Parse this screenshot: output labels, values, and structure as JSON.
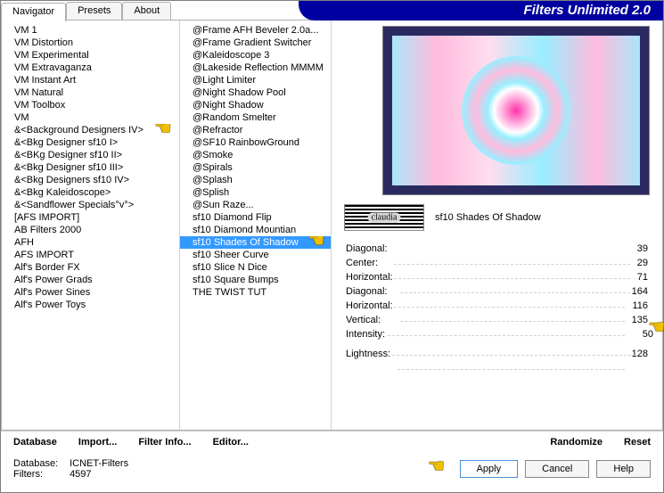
{
  "app": {
    "title": "Filters Unlimited 2.0"
  },
  "tabs": {
    "items": [
      "Navigator",
      "Presets",
      "About"
    ],
    "active_index": 0
  },
  "categories": {
    "items": [
      "VM 1",
      "VM Distortion",
      "VM Experimental",
      "VM Extravaganza",
      "VM Instant Art",
      "VM Natural",
      "VM Toolbox",
      "VM",
      "&<Background Designers IV>",
      "&<Bkg Designer sf10 I>",
      "&<BKg Designer sf10 II>",
      "&<Bkg Designer sf10 III>",
      "&<Bkg Designers sf10 IV>",
      "&<Bkg Kaleidoscope>",
      "&<Sandflower Specials°v°>",
      "[AFS IMPORT]",
      "AB Filters 2000",
      "AFH",
      "AFS IMPORT",
      "Alf's Border FX",
      "Alf's Power Grads",
      "Alf's Power Sines",
      "Alf's Power Toys"
    ],
    "highlighted_index": 8
  },
  "filters": {
    "items": [
      "@Frame AFH Beveler 2.0a...",
      "@Frame Gradient Switcher",
      "@Kaleidoscope 3",
      "@Lakeside Reflection MMMM",
      "@Light Limiter",
      "@Night Shadow Pool",
      "@Night Shadow",
      "@Random Smelter",
      "@Refractor",
      "@SF10 RainbowGround",
      "@Smoke",
      "@Spirals",
      "@Splash",
      "@Splish",
      "@Sun Raze...",
      "sf10 Diamond Flip",
      "sf10 Diamond Mountian",
      "sf10 Shades Of Shadow",
      "sf10 Sheer Curve",
      "sf10 Slice N Dice",
      "sf10 Square Bumps",
      "THE TWIST TUT"
    ],
    "selected_index": 17
  },
  "preview": {
    "filter_name": "sf10 Shades Of Shadow",
    "watermark_text": "claudia"
  },
  "params": [
    {
      "label": "Diagonal:",
      "value": 39
    },
    {
      "label": "Center:",
      "value": 29
    },
    {
      "label": "Horizontal:",
      "value": 71
    },
    {
      "label": "Diagonal:",
      "value": 164
    },
    {
      "label": "Horizontal:",
      "value": 116
    },
    {
      "label": "Vertical:",
      "value": 135
    },
    {
      "label": "Intensity:",
      "value": 50
    },
    {
      "label": "Lightness:",
      "value": 128
    }
  ],
  "bottom_links": {
    "database": "Database",
    "import": "Import...",
    "filter_info": "Filter Info...",
    "editor": "Editor...",
    "randomize": "Randomize",
    "reset": "Reset"
  },
  "status": {
    "database_label": "Database:",
    "database_value": "ICNET-Filters",
    "filters_label": "Filters:",
    "filters_value": "4597"
  },
  "buttons": {
    "apply": "Apply",
    "cancel": "Cancel",
    "help": "Help"
  },
  "pointers": {
    "param_index": 6
  }
}
